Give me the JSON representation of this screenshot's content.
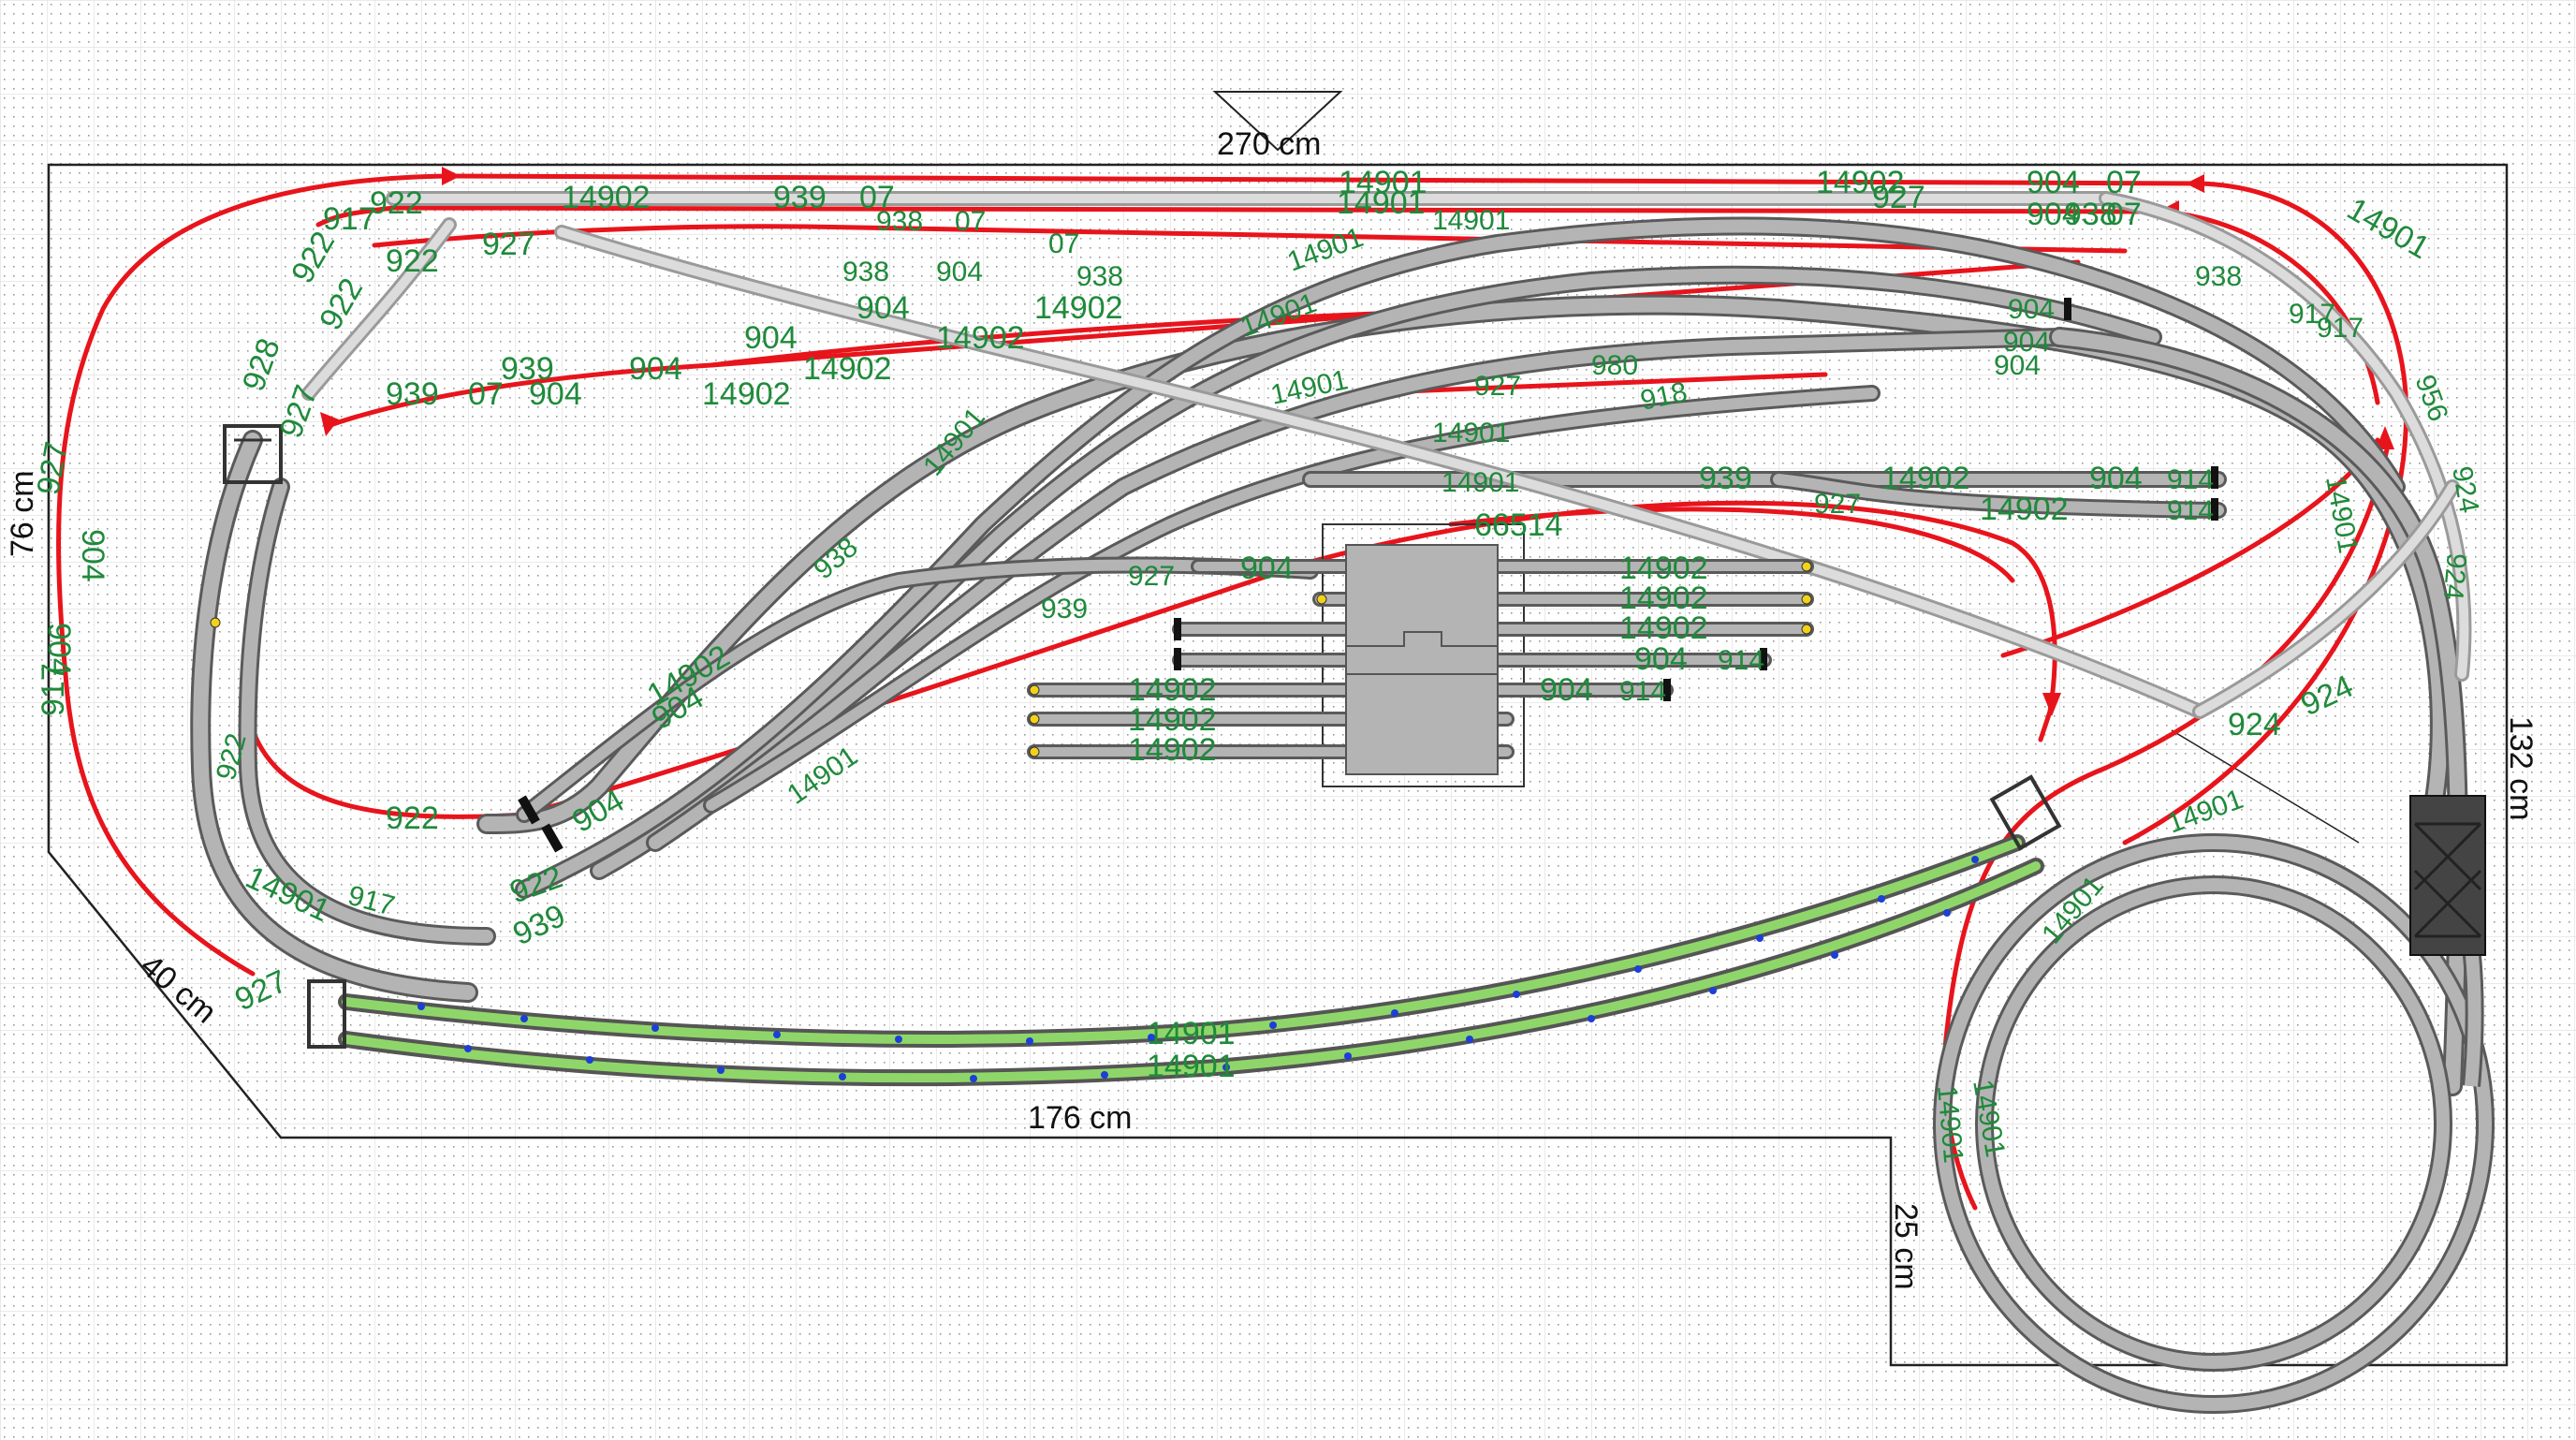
{
  "colors": {
    "board_outline": "#222222",
    "grid_dot": "#9a9a9a",
    "track_fill": "#b4b4b4",
    "track_edge": "#5a5a5a",
    "track_light": "#dcdcdc",
    "wire_red": "#e8141c",
    "part_label_green": "#1f8a3b",
    "flex_green": "#8fd66a",
    "buffer_black": "#111111",
    "accent_blue": "#1d3fd6",
    "marker_yellow": "#f2d11b"
  },
  "dimensions": {
    "width_top": "270 cm",
    "depth_left": "76 cm",
    "bevel_lower_left": "40 cm",
    "width_bottom": "176 cm",
    "notch_height": "25 cm",
    "depth_right": "132 cm"
  },
  "labels": {
    "top_row": [
      "14902",
      "939",
      "07",
      "938",
      "07",
      "14901",
      "14901",
      "14902",
      "927",
      "904",
      "07",
      "904",
      "07"
    ],
    "upper_left": [
      "917",
      "922",
      "922",
      "922",
      "927",
      "922",
      "928",
      "927"
    ],
    "upper_mid": [
      "938",
      "07",
      "904",
      "938",
      "904",
      "14902",
      "904",
      "14902",
      "939",
      "904",
      "14902",
      "939",
      "07",
      "904",
      "14902"
    ],
    "upper_right": [
      "14901",
      "938",
      "917",
      "917",
      "956",
      "924",
      "924",
      "938",
      "904",
      "904",
      "904"
    ],
    "center_diag": [
      "14901",
      "14901",
      "14901",
      "14901",
      "14901",
      "14901",
      "927",
      "980",
      "918",
      "14901",
      "939",
      "927",
      "14902",
      "904",
      "914",
      "14902",
      "914"
    ],
    "yard": [
      "66514",
      "14902",
      "14902",
      "14902",
      "904",
      "914",
      "904",
      "914",
      "14902",
      "14902",
      "14902",
      "904",
      "927",
      "939"
    ],
    "left_loop": [
      "927",
      "904",
      "904",
      "917",
      "14901",
      "927",
      "922",
      "917",
      "922",
      "939",
      "904",
      "904",
      "938",
      "922",
      "14902",
      "14901"
    ],
    "bottom": [
      "14901",
      "14901",
      "924",
      "924"
    ],
    "right_loop": [
      "14901",
      "14901",
      "14901",
      "14901",
      "14901"
    ]
  }
}
